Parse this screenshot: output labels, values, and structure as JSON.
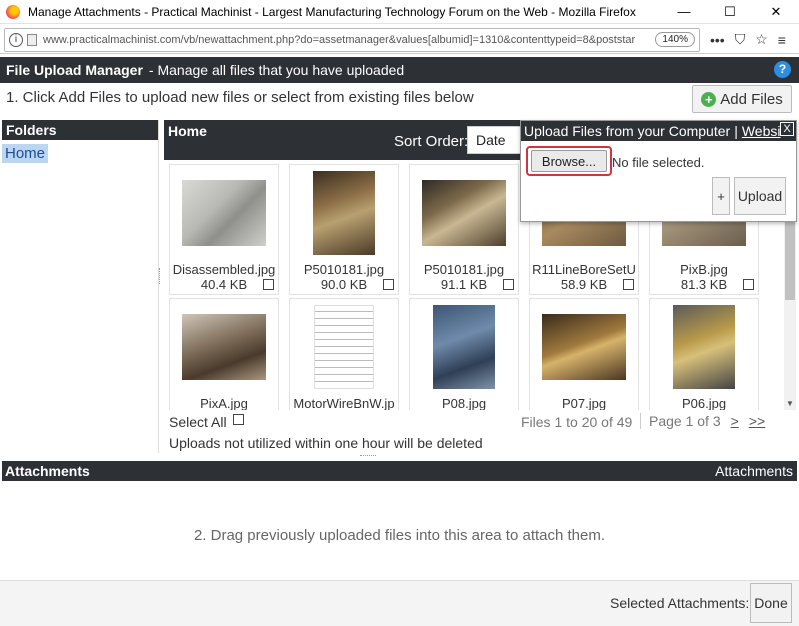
{
  "window": {
    "title": "Manage Attachments - Practical Machinist - Largest Manufacturing Technology Forum on the Web - Mozilla Firefox",
    "minimize": "—",
    "maximize": "☐",
    "close": "✕"
  },
  "urlbar": {
    "url": "www.practicalmachinist.com/vb/newattachment.php?do=assetmanager&values[albumid]=1310&contenttypeid=8&poststar",
    "zoom": "140%",
    "menu_icon": "•••",
    "pocket_icon": "⛉",
    "star_icon": "☆",
    "hamburger_icon": "≡"
  },
  "header": {
    "title": "File Upload Manager",
    "subtitle": "-  Manage all files that you have uploaded",
    "help": "?"
  },
  "step1": "1. Click Add Files to upload new files or select from existing files below",
  "add_files_label": "Add Files",
  "folders": {
    "header": "Folders",
    "items": [
      "Home"
    ]
  },
  "home_pane": {
    "title": "Home",
    "sort_label": "Sort Order:",
    "sort_value": "Date"
  },
  "files": [
    {
      "name": "Disassembled.jpg",
      "size": "40.4 KB",
      "thumb": "parts-gray"
    },
    {
      "name": "P5010181.jpg",
      "size": "90.0 KB",
      "thumb": "machine-color"
    },
    {
      "name": "P5010181.jpg",
      "size": "91.1 KB",
      "thumb": "machine-color-2"
    },
    {
      "name": "R11LineBoreSetU",
      "size": "58.9 KB",
      "thumb": "bore-setup"
    },
    {
      "name": "PixB.jpg",
      "size": "81.3 KB",
      "thumb": "pix-b"
    },
    {
      "name": "PixA.jpg",
      "size": "",
      "thumb": "lathe"
    },
    {
      "name": "MotorWireBnW.jp",
      "size": "",
      "thumb": "wiring-diagram"
    },
    {
      "name": "P08.jpg",
      "size": "",
      "thumb": "casting-blue"
    },
    {
      "name": "P07.jpg",
      "size": "",
      "thumb": "tape-measure"
    },
    {
      "name": "P06.jpg",
      "size": "",
      "thumb": "vise-gold"
    }
  ],
  "colors": {
    "thumb_parts_gray": "#b9b9b6",
    "thumb_machine": "#6b5a3c",
    "thumb_bore": "#8a6a48",
    "thumb_pix_b": "#9c8d74",
    "thumb_lathe": "#7b6a56",
    "thumb_casting": "#4d6a8e",
    "thumb_tape": "#7a5a2c",
    "thumb_vise": "#6a6a6a",
    "dark_bar": "#2d3136",
    "browse_highlight": "#d0343f"
  },
  "bottombar": {
    "select_all": "Select All",
    "files_count": "Files 1 to 20 of 49",
    "page_text": "Page 1 of 3",
    "next": ">",
    "last": ">>",
    "notice": "Uploads not utilized within one hour will be deleted"
  },
  "attachments": {
    "header_left": "Attachments",
    "header_right": "Attachments",
    "drag_msg": "2. Drag previously uploaded files into this area to attach them."
  },
  "footer": {
    "selected_label": "Selected Attachments:",
    "done": "Done"
  },
  "upload_panel": {
    "title": "Upload Files from your Computer",
    "sep": "|",
    "website_tab": "Websi",
    "close": "X",
    "browse": "Browse...",
    "nofile": "No file selected.",
    "plus": "+",
    "upload": "Upload"
  }
}
